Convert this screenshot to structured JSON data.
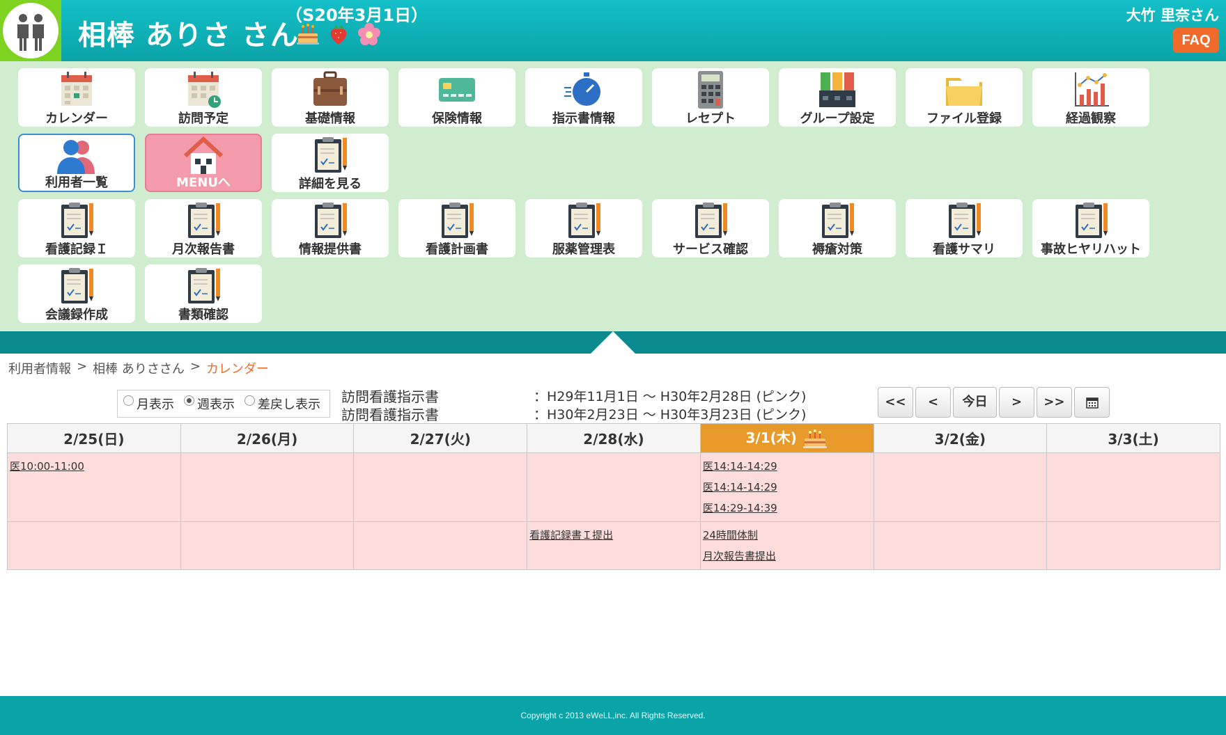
{
  "header": {
    "patient_name": "相棒 ありさ さん",
    "birthdate": "（S20年3月1日）",
    "user_name": "大竹 里奈さん",
    "faq_label": "FAQ"
  },
  "menu": {
    "row1": [
      "カレンダー",
      "訪問予定",
      "基礎情報",
      "保険情報",
      "指示書情報",
      "レセプト",
      "グループ設定",
      "ファイル登録",
      "経過観察"
    ],
    "row2": [
      "利用者一覧",
      "MENUへ",
      "詳細を見る"
    ],
    "row3": [
      "看護記録Ｉ",
      "月次報告書",
      "情報提供書",
      "看護計画書",
      "服薬管理表",
      "サービス確認",
      "褥瘡対策",
      "看護サマリ",
      "事故ヒヤリハット"
    ],
    "row4": [
      "会議録作成",
      "書類確認"
    ]
  },
  "breadcrumb": {
    "item1": "利用者情報",
    "sep": ">",
    "item2": "相棒 ありささん",
    "current": "カレンダー"
  },
  "view_options": {
    "month": "月表示",
    "week": "週表示",
    "returned": "差戻し表示",
    "selected": "週表示"
  },
  "instructions": [
    {
      "label": "訪問看護指示書",
      "range": "：H29年11月1日 ～ H30年2月28日 (ピンク)"
    },
    {
      "label": "訪問看護指示書",
      "range": "：H30年2月23日 ～ H30年3月23日 (ピンク)"
    }
  ],
  "nav": {
    "first": "<<",
    "prev": "<",
    "today": "今日",
    "next": ">",
    "last": ">>"
  },
  "calendar": {
    "days": [
      "2/25(日)",
      "2/26(月)",
      "2/27(火)",
      "2/28(水)",
      "3/1(木)",
      "3/2(金)",
      "3/3(土)"
    ],
    "today_index": 4,
    "row1": {
      "sun": [
        "医10:00-11:00"
      ],
      "thu": [
        "医14:14-14:29",
        "医14:14-14:29",
        "医14:29-14:39"
      ]
    },
    "row2": {
      "wed": [
        "看護記録書Ｉ提出"
      ],
      "thu": [
        "24時間体制",
        "月次報告書提出"
      ]
    }
  },
  "footer": {
    "copyright": "Copyright c 2013 eWeLL,inc. All Rights Reserved."
  },
  "colors": {
    "header": "#0aa3a8",
    "menu_bg": "#d0edd0",
    "today_header": "#e89a2a",
    "cell_bg": "#fddcdc",
    "accent": "#f06a2c"
  }
}
